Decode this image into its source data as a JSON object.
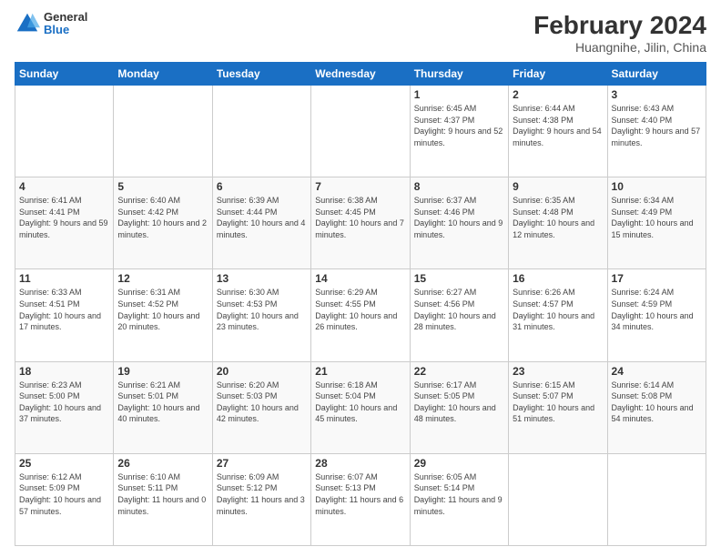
{
  "header": {
    "logo": {
      "general": "General",
      "blue": "Blue"
    },
    "title": "February 2024",
    "subtitle": "Huangnihe, Jilin, China"
  },
  "weekdays": [
    "Sunday",
    "Monday",
    "Tuesday",
    "Wednesday",
    "Thursday",
    "Friday",
    "Saturday"
  ],
  "weeks": [
    [
      {
        "day": "",
        "sunrise": "",
        "sunset": "",
        "daylight": ""
      },
      {
        "day": "",
        "sunrise": "",
        "sunset": "",
        "daylight": ""
      },
      {
        "day": "",
        "sunrise": "",
        "sunset": "",
        "daylight": ""
      },
      {
        "day": "",
        "sunrise": "",
        "sunset": "",
        "daylight": ""
      },
      {
        "day": "1",
        "sunrise": "6:45 AM",
        "sunset": "4:37 PM",
        "daylight": "9 hours and 52 minutes."
      },
      {
        "day": "2",
        "sunrise": "6:44 AM",
        "sunset": "4:38 PM",
        "daylight": "9 hours and 54 minutes."
      },
      {
        "day": "3",
        "sunrise": "6:43 AM",
        "sunset": "4:40 PM",
        "daylight": "9 hours and 57 minutes."
      }
    ],
    [
      {
        "day": "4",
        "sunrise": "6:41 AM",
        "sunset": "4:41 PM",
        "daylight": "9 hours and 59 minutes."
      },
      {
        "day": "5",
        "sunrise": "6:40 AM",
        "sunset": "4:42 PM",
        "daylight": "10 hours and 2 minutes."
      },
      {
        "day": "6",
        "sunrise": "6:39 AM",
        "sunset": "4:44 PM",
        "daylight": "10 hours and 4 minutes."
      },
      {
        "day": "7",
        "sunrise": "6:38 AM",
        "sunset": "4:45 PM",
        "daylight": "10 hours and 7 minutes."
      },
      {
        "day": "8",
        "sunrise": "6:37 AM",
        "sunset": "4:46 PM",
        "daylight": "10 hours and 9 minutes."
      },
      {
        "day": "9",
        "sunrise": "6:35 AM",
        "sunset": "4:48 PM",
        "daylight": "10 hours and 12 minutes."
      },
      {
        "day": "10",
        "sunrise": "6:34 AM",
        "sunset": "4:49 PM",
        "daylight": "10 hours and 15 minutes."
      }
    ],
    [
      {
        "day": "11",
        "sunrise": "6:33 AM",
        "sunset": "4:51 PM",
        "daylight": "10 hours and 17 minutes."
      },
      {
        "day": "12",
        "sunrise": "6:31 AM",
        "sunset": "4:52 PM",
        "daylight": "10 hours and 20 minutes."
      },
      {
        "day": "13",
        "sunrise": "6:30 AM",
        "sunset": "4:53 PM",
        "daylight": "10 hours and 23 minutes."
      },
      {
        "day": "14",
        "sunrise": "6:29 AM",
        "sunset": "4:55 PM",
        "daylight": "10 hours and 26 minutes."
      },
      {
        "day": "15",
        "sunrise": "6:27 AM",
        "sunset": "4:56 PM",
        "daylight": "10 hours and 28 minutes."
      },
      {
        "day": "16",
        "sunrise": "6:26 AM",
        "sunset": "4:57 PM",
        "daylight": "10 hours and 31 minutes."
      },
      {
        "day": "17",
        "sunrise": "6:24 AM",
        "sunset": "4:59 PM",
        "daylight": "10 hours and 34 minutes."
      }
    ],
    [
      {
        "day": "18",
        "sunrise": "6:23 AM",
        "sunset": "5:00 PM",
        "daylight": "10 hours and 37 minutes."
      },
      {
        "day": "19",
        "sunrise": "6:21 AM",
        "sunset": "5:01 PM",
        "daylight": "10 hours and 40 minutes."
      },
      {
        "day": "20",
        "sunrise": "6:20 AM",
        "sunset": "5:03 PM",
        "daylight": "10 hours and 42 minutes."
      },
      {
        "day": "21",
        "sunrise": "6:18 AM",
        "sunset": "5:04 PM",
        "daylight": "10 hours and 45 minutes."
      },
      {
        "day": "22",
        "sunrise": "6:17 AM",
        "sunset": "5:05 PM",
        "daylight": "10 hours and 48 minutes."
      },
      {
        "day": "23",
        "sunrise": "6:15 AM",
        "sunset": "5:07 PM",
        "daylight": "10 hours and 51 minutes."
      },
      {
        "day": "24",
        "sunrise": "6:14 AM",
        "sunset": "5:08 PM",
        "daylight": "10 hours and 54 minutes."
      }
    ],
    [
      {
        "day": "25",
        "sunrise": "6:12 AM",
        "sunset": "5:09 PM",
        "daylight": "10 hours and 57 minutes."
      },
      {
        "day": "26",
        "sunrise": "6:10 AM",
        "sunset": "5:11 PM",
        "daylight": "11 hours and 0 minutes."
      },
      {
        "day": "27",
        "sunrise": "6:09 AM",
        "sunset": "5:12 PM",
        "daylight": "11 hours and 3 minutes."
      },
      {
        "day": "28",
        "sunrise": "6:07 AM",
        "sunset": "5:13 PM",
        "daylight": "11 hours and 6 minutes."
      },
      {
        "day": "29",
        "sunrise": "6:05 AM",
        "sunset": "5:14 PM",
        "daylight": "11 hours and 9 minutes."
      },
      {
        "day": "",
        "sunrise": "",
        "sunset": "",
        "daylight": ""
      },
      {
        "day": "",
        "sunrise": "",
        "sunset": "",
        "daylight": ""
      }
    ]
  ]
}
